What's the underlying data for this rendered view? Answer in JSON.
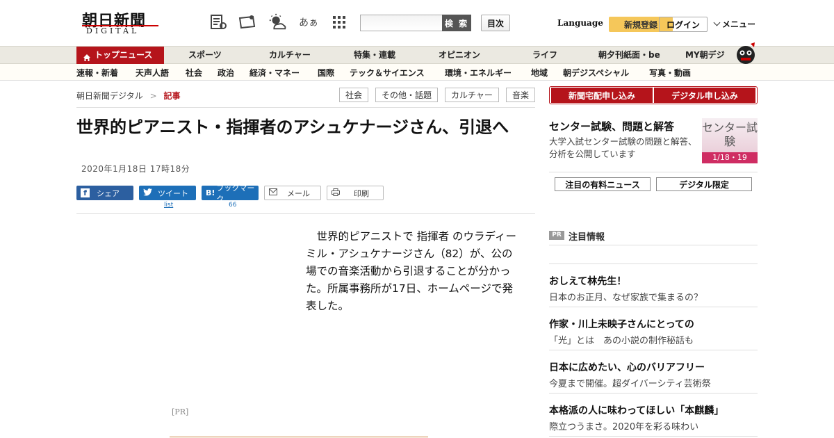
{
  "header": {
    "logo_main": "朝日新聞",
    "logo_sub": "DIGITAL",
    "search_button": "検 索",
    "mokuji_button": "目次",
    "language": "Language",
    "register": "新規登録",
    "login": "ログイン",
    "menu": "メニュー",
    "icon_moji": "あぁ"
  },
  "nav1": [
    {
      "label": "トップニュース"
    },
    {
      "label": "スポーツ"
    },
    {
      "label": "カルチャー"
    },
    {
      "label": "特集・連載"
    },
    {
      "label": "オピニオン"
    },
    {
      "label": "ライフ"
    },
    {
      "label": "朝夕刊紙面・be"
    },
    {
      "label": "MY朝デジ"
    }
  ],
  "nav2": [
    {
      "label": "速報・新着"
    },
    {
      "label": "天声人語"
    },
    {
      "label": "社会"
    },
    {
      "label": "政治"
    },
    {
      "label": "経済・マネー"
    },
    {
      "label": "国際"
    },
    {
      "label": "テック＆サイエンス"
    },
    {
      "label": "環境・エネルギー"
    },
    {
      "label": "地域"
    },
    {
      "label": "朝デジスペシャル"
    },
    {
      "label": "写真・動画"
    }
  ],
  "breadcrumb": {
    "home": "朝日新聞デジタル",
    "sep": ">",
    "current": "記事"
  },
  "tags": [
    "社会",
    "その他・話題",
    "カルチャー",
    "音楽"
  ],
  "article": {
    "headline": "世界的ピアニスト・指揮者のアシュケナージさん、引退へ",
    "date": "2020年1月18日 17時18分",
    "body": "　世界的ピアニストで 指揮者 のウラディーミル・アシュケナージさん（82）が、公の場での音楽活動から引退することが分かった。所属事務所が17日、ホームページで発表した。",
    "pr_label": "[PR]"
  },
  "share": {
    "facebook": "シェア",
    "twitter": "ツイート",
    "twitter_count": "list",
    "hatena": "ブックマーク",
    "hatena_count": "66",
    "mail": "メール",
    "print": "印刷"
  },
  "sidebar": {
    "btn_paper": "新聞宅配申し込み",
    "btn_digital": "デジタル申し込み",
    "center_title": "センター試験、問題と解答",
    "center_desc": "大学入試センター試験の問題と解答、分析を公開しています",
    "center_img_text": "センター試験",
    "center_img_date": "1/18・19",
    "btn_paid_news": "注目の有料ニュース",
    "btn_digital_limited": "デジタル限定",
    "pr_badge": "PR",
    "pr_heading": "注目情報",
    "pr_items": [
      {
        "title": "おしえて林先生！",
        "sub": "日本のお正月、なぜ家族で集まるの？"
      },
      {
        "title": "作家・川上未映子さんにとっての",
        "sub": "「光」とは　あの小説の制作秘話も"
      },
      {
        "title": "日本に広めたい、心のバリアフリー",
        "sub": "今夏まで開催。超ダイバーシティ芸術祭"
      },
      {
        "title": "本格派の人に味わってほしい「本麒麟」",
        "sub": "際立つうまさ。2020年を彩る味わい"
      }
    ]
  },
  "colors": {
    "brand_red": "#b5141b",
    "register_yellow": "#f5c75a",
    "twitter_blue": "#1d6fb8"
  }
}
